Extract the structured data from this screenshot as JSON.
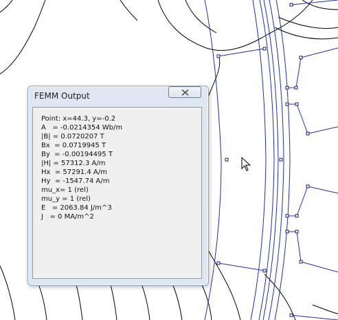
{
  "window": {
    "title": "FEMM Output"
  },
  "output": {
    "lines": [
      "Point: x=44.3, y=-0.2",
      "A   = -0.0214354 Wb/m",
      "|B| = 0.0720207 T",
      "Bx  = 0.0719945 T",
      "By  = -0.00194495 T",
      "|H| = 57312.3 A/m",
      "Hx  = 57291.4 A/m",
      "Hy  = -1547.74 A/m",
      "mu_x= 1 (rel)",
      "mu_y = 1 (rel)",
      "E   = 2063.84 J/m^3",
      "J   = 0 MA/m^2"
    ]
  },
  "colors": {
    "mesh_blue": "#1f2fa8",
    "contour_black": "#000000",
    "node": "#1a1a6a"
  },
  "icons": {
    "close": "close-icon",
    "cursor": "mouse-pointer-icon"
  }
}
